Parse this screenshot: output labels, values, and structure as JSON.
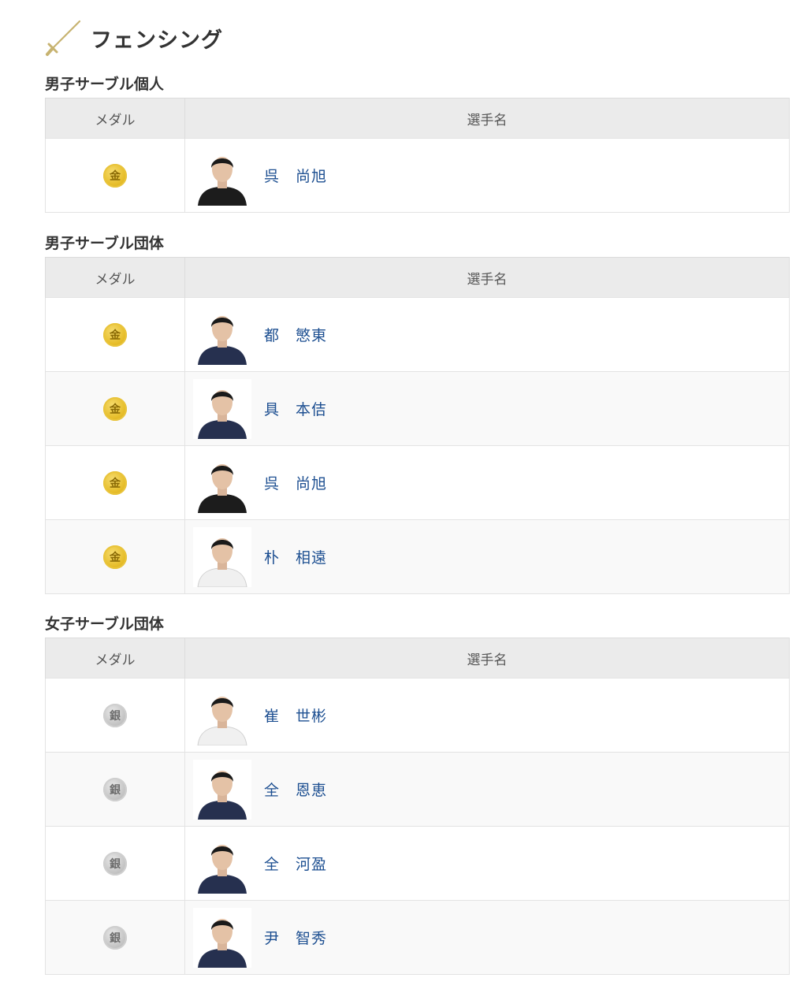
{
  "sport": {
    "title": "フェンシング",
    "icon": "fencing-sword-icon",
    "icon_color": "#c7b370"
  },
  "table_headers": {
    "medal": "メダル",
    "player": "選手名"
  },
  "colors": {
    "gold": "#e6bd2a",
    "silver": "#c4c4c4",
    "link": "#1d4f91"
  },
  "sections": [
    {
      "title": "男子サーブル個人",
      "rows": [
        {
          "medal": "金",
          "medal_type": "gold",
          "name": "呉　尚旭",
          "jersey": "black"
        }
      ]
    },
    {
      "title": "男子サーブル団体",
      "rows": [
        {
          "medal": "金",
          "medal_type": "gold",
          "name": "都　慜東",
          "jersey": "navy"
        },
        {
          "medal": "金",
          "medal_type": "gold",
          "name": "具　本佶",
          "jersey": "navy"
        },
        {
          "medal": "金",
          "medal_type": "gold",
          "name": "呉　尚旭",
          "jersey": "black"
        },
        {
          "medal": "金",
          "medal_type": "gold",
          "name": "朴　相遠",
          "jersey": "white"
        }
      ]
    },
    {
      "title": "女子サーブル団体",
      "rows": [
        {
          "medal": "銀",
          "medal_type": "silver",
          "name": "崔　世彬",
          "jersey": "white"
        },
        {
          "medal": "銀",
          "medal_type": "silver",
          "name": "全　恩恵",
          "jersey": "navy"
        },
        {
          "medal": "銀",
          "medal_type": "silver",
          "name": "全　河盈",
          "jersey": "navy"
        },
        {
          "medal": "銀",
          "medal_type": "silver",
          "name": "尹　智秀",
          "jersey": "navy"
        }
      ]
    }
  ]
}
